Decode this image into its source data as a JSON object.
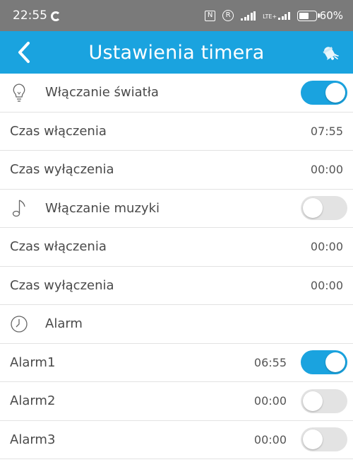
{
  "status_bar": {
    "time": "22:55",
    "battery_percent": "60%",
    "battery_level": 0.6,
    "network_label": "LTE+"
  },
  "header": {
    "title": "Ustawienia timera",
    "back_icon": "chevron-left-icon",
    "right_icon": "bell-icon"
  },
  "colors": {
    "accent": "#1aa3df",
    "status_bar": "#7a7a7a",
    "toggle_off": "#e3e3e3"
  },
  "light": {
    "section_label": "Włączanie światła",
    "icon": "lightbulb-icon",
    "enabled": true,
    "on_label": "Czas włączenia",
    "on_time": "07:55",
    "off_label": "Czas wyłączenia",
    "off_time": "00:00"
  },
  "music": {
    "section_label": "Włączanie muzyki",
    "icon": "music-note-icon",
    "enabled": false,
    "on_label": "Czas włączenia",
    "on_time": "00:00",
    "off_label": "Czas wyłączenia",
    "off_time": "00:00"
  },
  "alarm": {
    "section_label": "Alarm",
    "icon": "clock-icon",
    "items": [
      {
        "label": "Alarm1",
        "time": "06:55",
        "enabled": true
      },
      {
        "label": "Alarm2",
        "time": "00:00",
        "enabled": false
      },
      {
        "label": "Alarm3",
        "time": "00:00",
        "enabled": false
      }
    ]
  }
}
